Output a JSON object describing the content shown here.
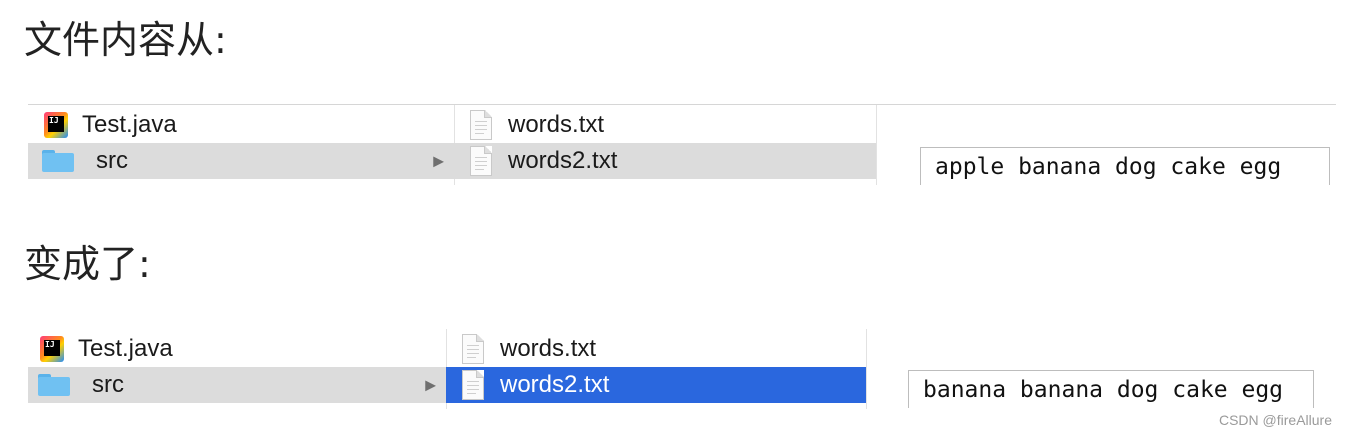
{
  "before": {
    "heading": "文件内容从:",
    "column1": [
      {
        "label": "Test.java",
        "icon": "intellij-java-file-icon"
      },
      {
        "label": "src",
        "icon": "folder-icon",
        "has_arrow": true,
        "selected": "grey"
      }
    ],
    "column2": [
      {
        "label": "words.txt",
        "icon": "text-document-icon"
      },
      {
        "label": "words2.txt",
        "icon": "text-document-icon",
        "selected": "grey"
      }
    ],
    "file_content": "apple banana dog cake egg"
  },
  "after": {
    "heading": "变成了:",
    "column1": [
      {
        "label": "Test.java",
        "icon": "intellij-java-file-icon"
      },
      {
        "label": "src",
        "icon": "folder-icon",
        "has_arrow": true,
        "selected": "grey"
      }
    ],
    "column2": [
      {
        "label": "words.txt",
        "icon": "text-document-icon"
      },
      {
        "label": "words2.txt",
        "icon": "text-document-icon",
        "selected": "blue"
      }
    ],
    "file_content": "banana banana dog cake egg"
  },
  "arrow_glyph": "▶",
  "watermark": "CSDN @fireAllure",
  "colors": {
    "selection_blue": "#2a67de",
    "selection_grey": "#dcdcdc",
    "folder_blue": "#70c1f2"
  }
}
